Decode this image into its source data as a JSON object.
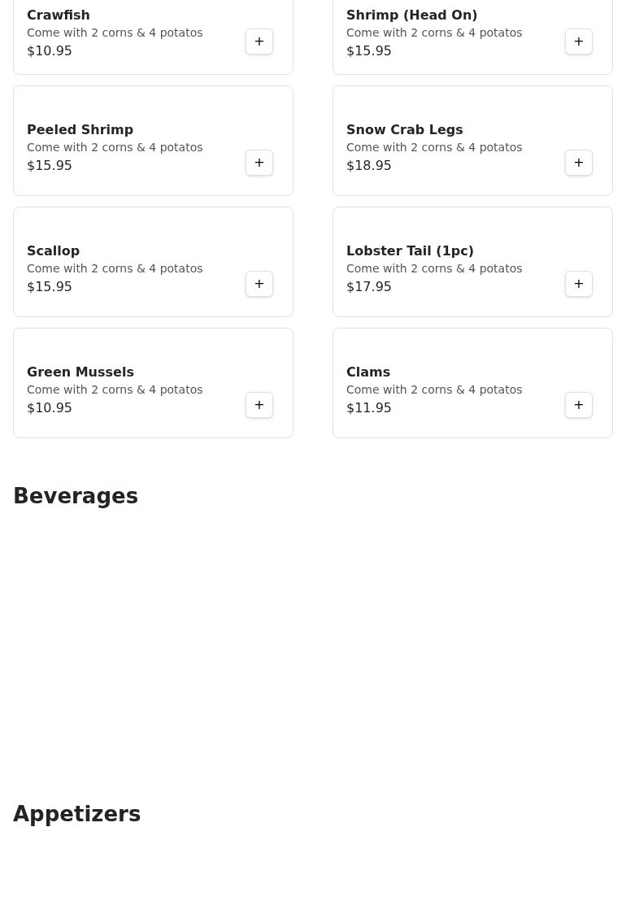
{
  "items": [
    {
      "name": "Crawfish",
      "description": "Come with 2 corns & 4 potatos",
      "price": "$10.95",
      "add_label": "+"
    },
    {
      "name": "Shrimp (Head On)",
      "description": "Come with 2 corns & 4 potatos",
      "price": "$15.95",
      "add_label": "+"
    },
    {
      "name": "Peeled Shrimp",
      "description": "Come with 2 corns & 4 potatos",
      "price": "$15.95",
      "add_label": "+"
    },
    {
      "name": "Snow Crab Legs",
      "description": "Come with 2 corns & 4 potatos",
      "price": "$18.95",
      "add_label": "+"
    },
    {
      "name": "Scallop",
      "description": "Come with 2 corns & 4 potatos",
      "price": "$15.95",
      "add_label": "+"
    },
    {
      "name": "Lobster Tail (1pc)",
      "description": "Come with 2 corns & 4 potatos",
      "price": "$17.95",
      "add_label": "+"
    },
    {
      "name": "Green Mussels",
      "description": "Come with 2 corns & 4 potatos",
      "price": "$10.95",
      "add_label": "+"
    },
    {
      "name": "Clams",
      "description": "Come with 2 corns & 4 potatos",
      "price": "$11.95",
      "add_label": "+"
    }
  ],
  "sections": [
    {
      "title": "Beverages"
    },
    {
      "title": "Appetizers"
    }
  ]
}
